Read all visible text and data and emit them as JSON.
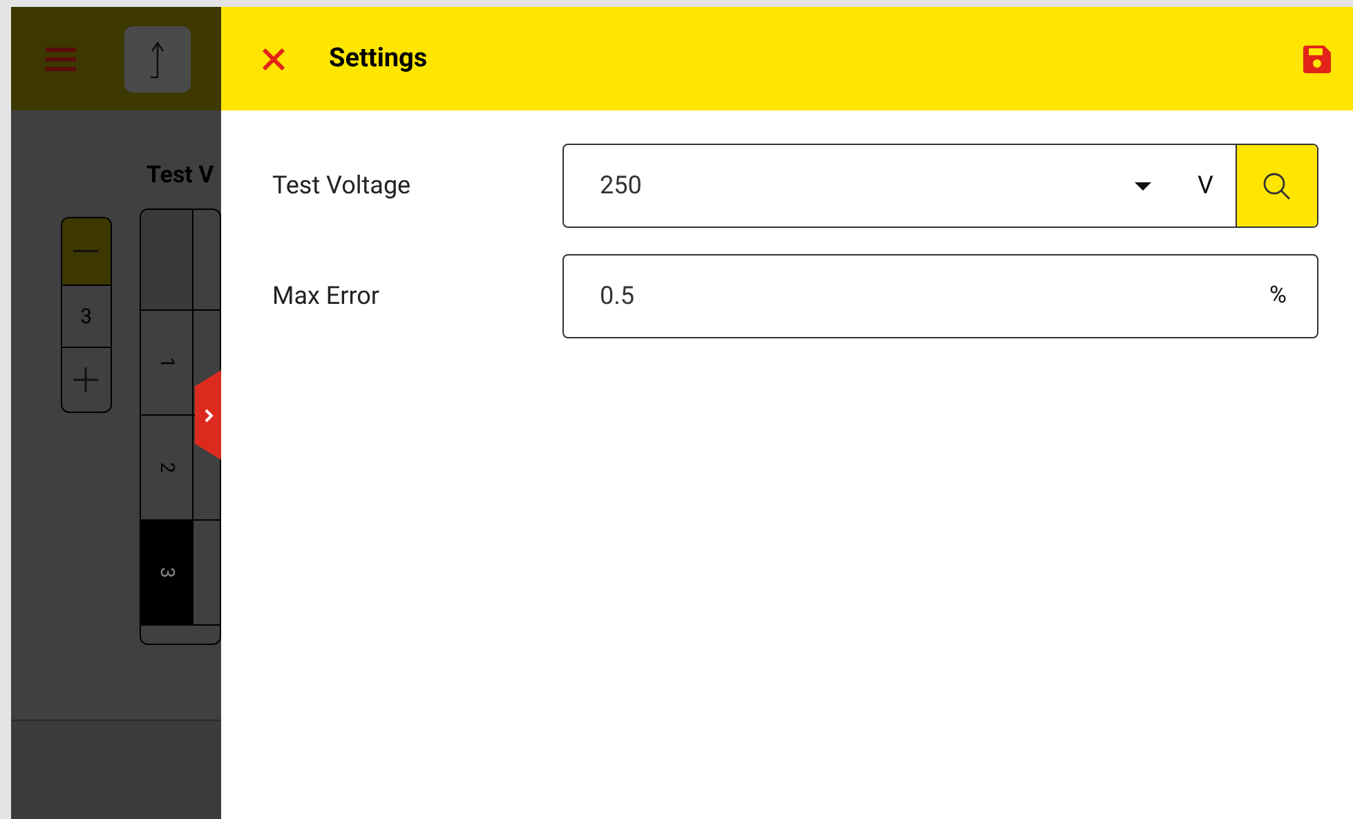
{
  "background": {
    "heading": "Test V",
    "stepper": {
      "value": "3"
    },
    "table": {
      "rows": [
        {
          "label": "1",
          "selected": false
        },
        {
          "label": "2",
          "selected": false
        },
        {
          "label": "3",
          "selected": true
        }
      ]
    }
  },
  "settings": {
    "title": "Settings",
    "fields": [
      {
        "kind": "dropdown",
        "label": "Test Voltage",
        "value": "250",
        "unit": "V"
      },
      {
        "kind": "text",
        "label": "Max Error",
        "value": "0.5",
        "unit": "%"
      }
    ]
  }
}
